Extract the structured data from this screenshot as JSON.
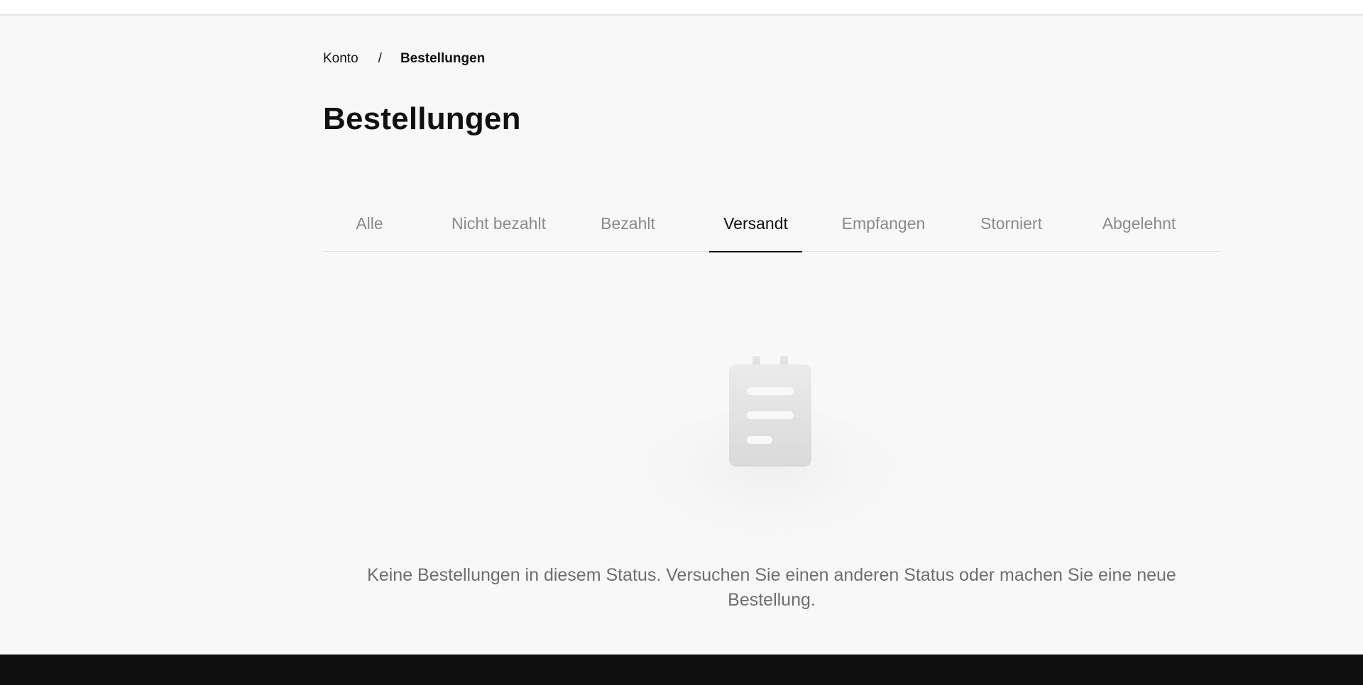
{
  "breadcrumb": {
    "items": [
      {
        "label": "Konto"
      },
      {
        "label": "Bestellungen"
      }
    ],
    "separator": "/"
  },
  "page": {
    "title": "Bestellungen"
  },
  "tabs": [
    {
      "label": "Alle",
      "active": false
    },
    {
      "label": "Nicht bezahlt",
      "active": false
    },
    {
      "label": "Bezahlt",
      "active": false
    },
    {
      "label": "Versandt",
      "active": true
    },
    {
      "label": "Empfangen",
      "active": false
    },
    {
      "label": "Storniert",
      "active": false
    },
    {
      "label": "Abgelehnt",
      "active": false
    }
  ],
  "empty_state": {
    "icon": "clipboard-icon",
    "message": "Keine Bestellungen in diesem Status. Versuchen Sie einen anderen Status oder machen Sie eine neue Bestellung."
  },
  "colors": {
    "background": "#f8f8f8",
    "active_tab": "#111111",
    "inactive_tab": "#8a8a8a",
    "footer": "#0f0f0f"
  }
}
